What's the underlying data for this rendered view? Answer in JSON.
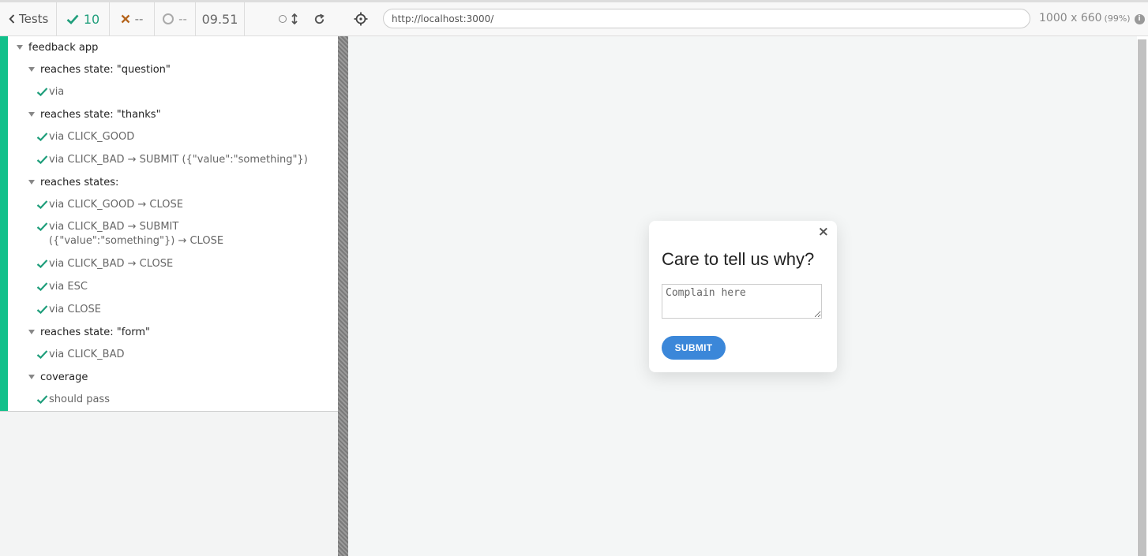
{
  "reporter": {
    "tests_label": "Tests",
    "passed_count": "10",
    "failed_count": "--",
    "pending_count": "--",
    "duration": "09.51",
    "status_color": "#11c08a"
  },
  "tree": {
    "root_suite": "feedback app",
    "suites": [
      {
        "title": "reaches state: \"question\"",
        "tests": [
          "via"
        ]
      },
      {
        "title": "reaches state: \"thanks\"",
        "tests": [
          "via CLICK_GOOD",
          "via CLICK_BAD → SUBMIT ({\"value\":\"something\"})"
        ]
      },
      {
        "title": "reaches states:",
        "tests": [
          "via CLICK_GOOD → CLOSE",
          "via CLICK_BAD → SUBMIT ({\"value\":\"something\"}) → CLOSE",
          "via CLICK_BAD → CLOSE",
          "via ESC",
          "via CLOSE"
        ]
      },
      {
        "title": "reaches state: \"form\"",
        "tests": [
          "via CLICK_BAD"
        ]
      },
      {
        "title": "coverage",
        "tests": [
          "should pass"
        ]
      }
    ]
  },
  "runner": {
    "url": "http://localhost:3000/",
    "viewport": "1000 x 660",
    "zoom": "(99%)",
    "info_icon_char": "i"
  },
  "app": {
    "close_glyph": "×",
    "title": "Care to tell us why?",
    "textarea_placeholder": "Complain here",
    "submit_label": "SUBMIT",
    "accent": "#3b87d9"
  }
}
